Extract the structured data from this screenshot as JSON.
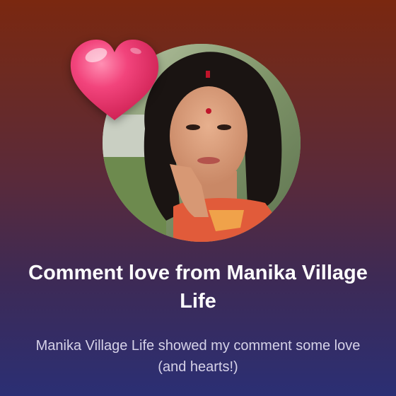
{
  "notification": {
    "title": "Comment love from Manika Village Life",
    "message": "Manika Village Life showed my comment some love (and hearts!)",
    "icon": "heart-icon",
    "avatar": "profile-avatar"
  },
  "colors": {
    "background_top": "#7a2810",
    "background_bottom": "#2b2f74",
    "heart": "#ef2f6e",
    "title_text": "#ffffff",
    "message_text": "#d6d2e8"
  }
}
